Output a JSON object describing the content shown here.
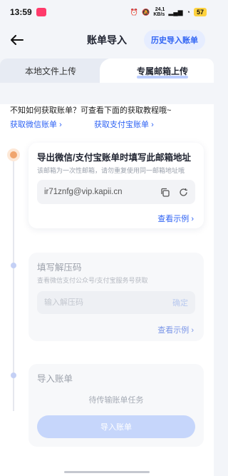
{
  "status_bar": {
    "time": "13:59",
    "net_speed": "24.1",
    "net_unit": "KB/s",
    "battery": "57"
  },
  "header": {
    "title": "账单导入",
    "history_button": "历史导入账单"
  },
  "tabs": [
    {
      "label": "本地文件上传",
      "active": false
    },
    {
      "label": "专属邮箱上传",
      "active": true
    }
  ],
  "tip": "不知如何获取账单？可查看下面的获取教程哦~",
  "links": {
    "wechat": "获取微信账单",
    "alipay": "获取支付宝账单"
  },
  "steps": {
    "email": {
      "title": "导出微信/支付宝账单时填写此邮箱地址",
      "subtitle": "该邮箱为一次性邮箱，请勿重复使用同一邮箱地址哦",
      "email": "ir71znfg@vip.kapii.cn",
      "example": "查看示例"
    },
    "password": {
      "title": "填写解压码",
      "subtitle": "查看微信支付公众号/支付宝服务号获取",
      "placeholder": "输入解压码",
      "confirm": "确定",
      "example": "查看示例"
    },
    "import": {
      "title": "导入账单",
      "pending": "待传输账单任务",
      "button": "导入账单"
    }
  },
  "colors": {
    "accent": "#2f63f4",
    "accent_light": "#e6edff",
    "disabled_button": "#c6d6fb"
  }
}
